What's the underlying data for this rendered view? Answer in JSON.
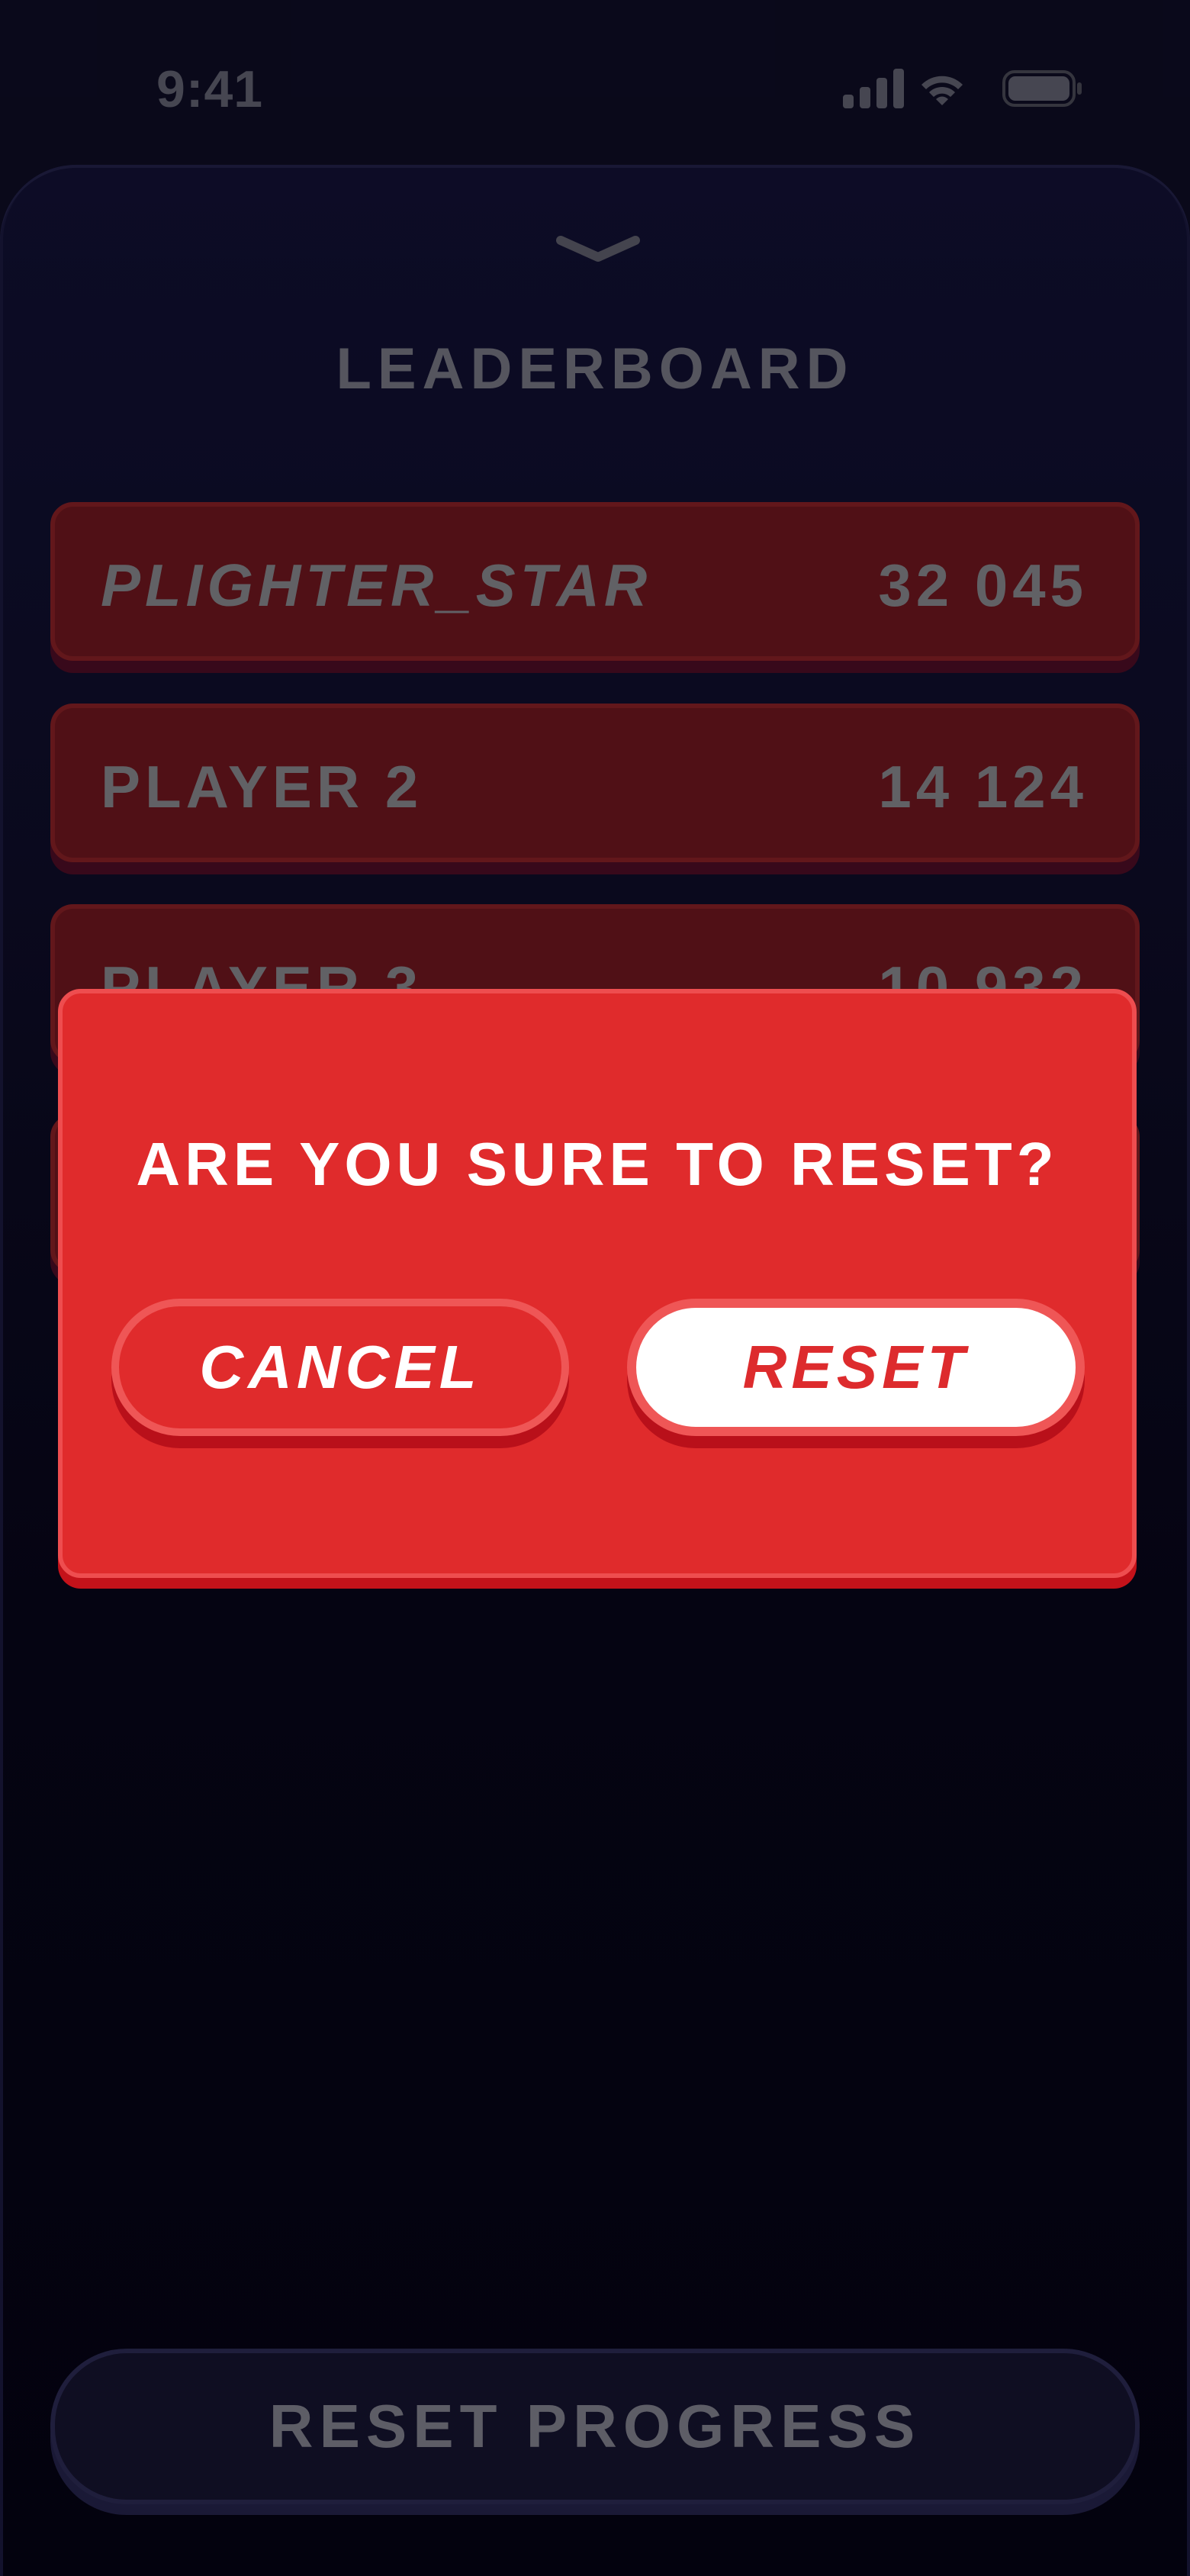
{
  "status_bar": {
    "time": "9:41"
  },
  "sheet": {
    "title": "LEADERBOARD"
  },
  "leaderboard": [
    {
      "name": "PLIGHTER_STAR",
      "score": "32 045"
    },
    {
      "name": "PLAYER 2",
      "score": "14 124"
    },
    {
      "name": "PLAYER 3",
      "score": "10 932"
    }
  ],
  "dialog": {
    "title": "ARE YOU SURE TO RESET?",
    "cancel_label": "CANCEL",
    "confirm_label": "RESET"
  },
  "footer": {
    "reset_progress_label": "RESET PROGRESS"
  },
  "colors": {
    "background": "#0b0a1d",
    "row_fill": "#571218",
    "dialog_red": "#e02b2c",
    "button_border": "#ef5656",
    "muted_text": "#5d5d66"
  },
  "icons": [
    "signal-icon",
    "wifi-icon",
    "battery-icon",
    "chevron-down-icon"
  ]
}
